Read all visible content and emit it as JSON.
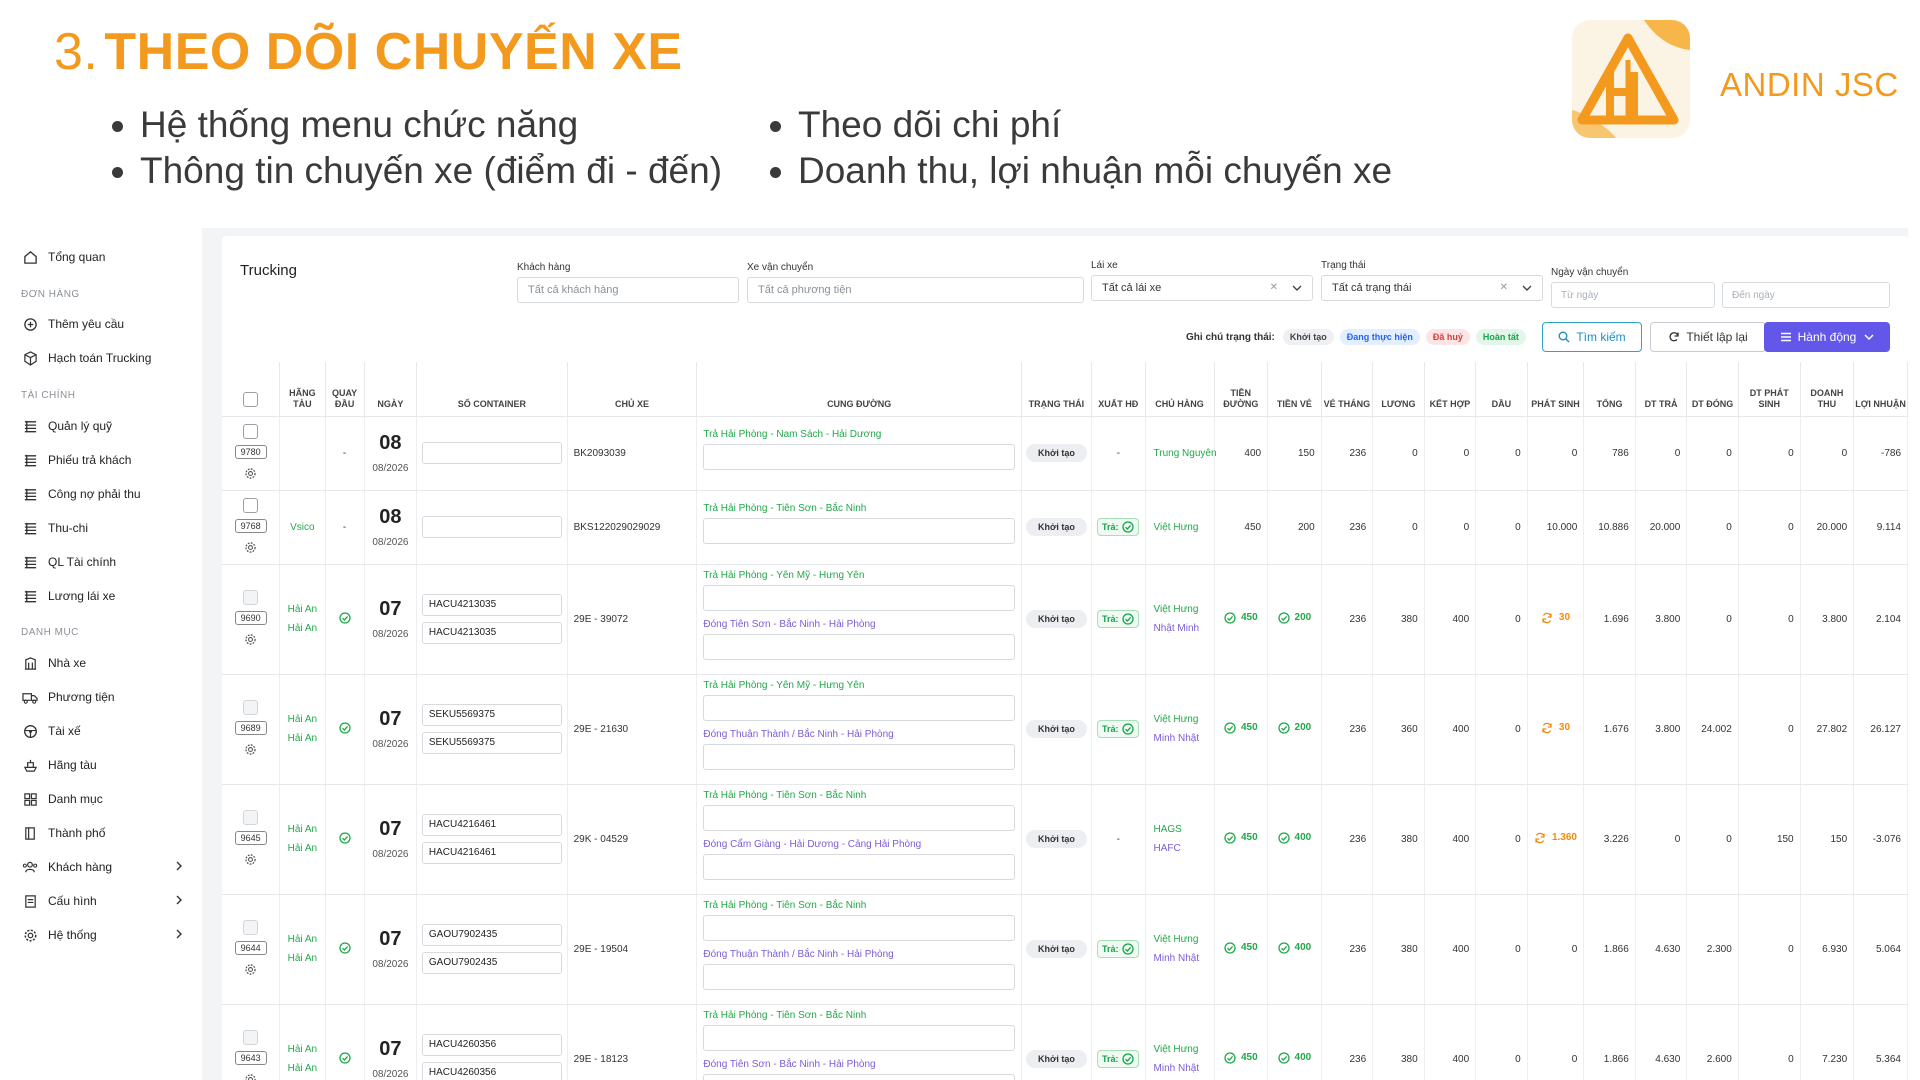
{
  "slide": {
    "number": "3.",
    "title": "THEO DÕI CHUYẾN XE",
    "bullets_left": [
      "Hệ thống menu chức năng",
      "Thông tin chuyến xe (điểm đi - đến)"
    ],
    "bullets_right": [
      "Theo dõi chi phí",
      "Doanh thu, lợi nhuận mỗi chuyến xe"
    ],
    "company": "ANDIN JSC"
  },
  "colors": {
    "accent": "#f39a1e",
    "primary_button": "#6257e8",
    "success": "#20a84a",
    "route_return": "#7c5cd6",
    "warning": "#f28a12"
  },
  "sidebar": {
    "overview": "Tổng quan",
    "sections": {
      "orders": "ĐƠN HÀNG",
      "finance": "TÀI CHÍNH",
      "catalog": "DANH MỤC"
    },
    "orders": [
      "Thêm yêu cầu",
      "Hạch toán Trucking"
    ],
    "finance": [
      "Quản lý quỹ",
      "Phiếu trả khách",
      "Công nợ phải thu",
      "Thu-chi",
      "QL Tài chính",
      "Lương lái xe"
    ],
    "catalog": [
      "Nhà xe",
      "Phương tiện",
      "Tài xế",
      "Hãng tàu",
      "Danh mục",
      "Thành phố",
      "Khách hàng",
      "Cấu hình",
      "Hệ thống"
    ]
  },
  "filters": {
    "title": "Trucking",
    "customer_label": "Khách hàng",
    "customer_ph": "Tất cả khách hàng",
    "vehicle_label": "Xe vận chuyển",
    "vehicle_ph": "Tất cả phương tiện",
    "driver_label": "Lái xe",
    "driver_value": "Tất cả lái xe",
    "status_label": "Trạng thái",
    "status_value": "Tất cả trạng thái",
    "date_label": "Ngày vận chuyển",
    "from_ph": "Từ ngày",
    "to_ph": "Đến ngày",
    "status_note_label": "Ghi chú trạng thái:",
    "status_legend": [
      "Khởi tạo",
      "Đang thực hiện",
      "Đã huỷ",
      "Hoàn tất"
    ],
    "search_btn": "Tìm kiếm",
    "reset_btn": "Thiết lập lại",
    "action_btn": "Hành động"
  },
  "table": {
    "headers": [
      "",
      "HÃNG TÀU",
      "QUAY ĐẦU",
      "NGÀY",
      "SỐ CONTAINER",
      "CHỦ XE",
      "CUNG ĐƯỜNG",
      "TRẠNG THÁI",
      "XUẤT HĐ",
      "CHỦ HÀNG",
      "TIỀN ĐƯỜNG",
      "TIỀN VÉ",
      "VÉ THÁNG",
      "LƯƠNG",
      "KẾT HỢP",
      "DẦU",
      "PHÁT SINH",
      "TỔNG",
      "DT TRẢ",
      "DT ĐÓNG",
      "DT PHÁT SINH",
      "DOANH THU",
      "LỢI NHUẬN"
    ],
    "tra_label": "Trả:",
    "rows": [
      {
        "id": "9780",
        "carrier": [],
        "turn": "-",
        "day": "08",
        "month": "08/2026",
        "containers": [
          ""
        ],
        "owner": "BK2093039",
        "routes": [
          "Trả Hải Phòng - Nam Sách - Hải Dương"
        ],
        "status": "Khởi tạo",
        "invoice": "-",
        "shippers": [
          "Trung Nguyên"
        ],
        "road": "400",
        "road_ok": false,
        "ticket": "150",
        "ticket_ok": false,
        "monthly": "236",
        "salary": "0",
        "combined": "0",
        "fuel": "0",
        "extra": "0",
        "extra_warn": false,
        "total": "786",
        "dt_return": "0",
        "dt_close": "0",
        "dt_extra": "0",
        "revenue": "0",
        "profit": "-786"
      },
      {
        "id": "9768",
        "carrier": [
          "Vsico"
        ],
        "turn": "-",
        "day": "08",
        "month": "08/2026",
        "containers": [
          ""
        ],
        "owner": "BKS122029029029",
        "routes": [
          "Trả Hải Phòng - Tiên Sơn - Bắc Ninh"
        ],
        "status": "Khởi tạo",
        "invoice": "tra",
        "shippers": [
          "Việt Hưng"
        ],
        "road": "450",
        "road_ok": false,
        "ticket": "200",
        "ticket_ok": false,
        "monthly": "236",
        "salary": "0",
        "combined": "0",
        "fuel": "0",
        "extra": "10.000",
        "extra_warn": false,
        "total": "10.886",
        "dt_return": "20.000",
        "dt_close": "0",
        "dt_extra": "0",
        "revenue": "20.000",
        "profit": "9.114"
      },
      {
        "id": "9690",
        "carrier": [
          "Hải An",
          "Hải An"
        ],
        "turn": "ok",
        "day": "07",
        "month": "08/2026",
        "containers": [
          "HACU4213035",
          "HACU4213035"
        ],
        "owner": "29E - 39072",
        "routes": [
          "Trả Hải Phòng - Yên Mỹ - Hưng Yên",
          "Đóng Tiên Sơn - Bắc Ninh - Hải Phòng"
        ],
        "status": "Khởi tạo",
        "invoice": "tra",
        "shippers": [
          "Việt Hưng",
          "Nhật Minh"
        ],
        "road": "450",
        "road_ok": true,
        "ticket": "200",
        "ticket_ok": true,
        "monthly": "236",
        "salary": "380",
        "combined": "400",
        "fuel": "0",
        "extra": "30",
        "extra_warn": true,
        "total": "1.696",
        "dt_return": "3.800",
        "dt_close": "0",
        "dt_extra": "0",
        "revenue": "3.800",
        "profit": "2.104"
      },
      {
        "id": "9689",
        "carrier": [
          "Hải An",
          "Hải An"
        ],
        "turn": "ok",
        "day": "07",
        "month": "08/2026",
        "containers": [
          "SEKU5569375",
          "SEKU5569375"
        ],
        "owner": "29E - 21630",
        "routes": [
          "Trả Hải Phòng - Yên Mỹ - Hưng Yên",
          "Đóng Thuận Thành / Bắc Ninh - Hải Phòng"
        ],
        "status": "Khởi tạo",
        "invoice": "tra",
        "shippers": [
          "Việt Hưng",
          "Minh Nhật"
        ],
        "road": "450",
        "road_ok": true,
        "ticket": "200",
        "ticket_ok": true,
        "monthly": "236",
        "salary": "360",
        "combined": "400",
        "fuel": "0",
        "extra": "30",
        "extra_warn": true,
        "total": "1.676",
        "dt_return": "3.800",
        "dt_close": "24.002",
        "dt_extra": "0",
        "revenue": "27.802",
        "profit": "26.127"
      },
      {
        "id": "9645",
        "carrier": [
          "Hải An",
          "Hải An"
        ],
        "turn": "ok",
        "day": "07",
        "month": "08/2026",
        "containers": [
          "HACU4216461",
          "HACU4216461"
        ],
        "owner": "29K - 04529",
        "routes": [
          "Trả Hải Phòng - Tiên Sơn - Bắc Ninh",
          "Đóng Cẩm Giàng - Hải Dương - Cảng Hải Phòng"
        ],
        "status": "Khởi tạo",
        "invoice": "-",
        "shippers": [
          "HAGS",
          "HAFC"
        ],
        "road": "450",
        "road_ok": true,
        "ticket": "400",
        "ticket_ok": true,
        "monthly": "236",
        "salary": "380",
        "combined": "400",
        "fuel": "0",
        "extra": "1.360",
        "extra_warn": true,
        "total": "3.226",
        "dt_return": "0",
        "dt_close": "0",
        "dt_extra": "150",
        "revenue": "150",
        "profit": "-3.076"
      },
      {
        "id": "9644",
        "carrier": [
          "Hải An",
          "Hải An"
        ],
        "turn": "ok",
        "day": "07",
        "month": "08/2026",
        "containers": [
          "GAOU7902435",
          "GAOU7902435"
        ],
        "owner": "29E - 19504",
        "routes": [
          "Trả Hải Phòng - Tiên Sơn - Bắc Ninh",
          "Đóng Thuận Thành / Bắc Ninh - Hải Phòng"
        ],
        "status": "Khởi tạo",
        "invoice": "tra",
        "shippers": [
          "Việt Hưng",
          "Minh Nhật"
        ],
        "road": "450",
        "road_ok": true,
        "ticket": "400",
        "ticket_ok": true,
        "monthly": "236",
        "salary": "380",
        "combined": "400",
        "fuel": "0",
        "extra": "0",
        "extra_warn": false,
        "total": "1.866",
        "dt_return": "4.630",
        "dt_close": "2.300",
        "dt_extra": "0",
        "revenue": "6.930",
        "profit": "5.064"
      },
      {
        "id": "9643",
        "carrier": [
          "Hải An",
          "Hải An"
        ],
        "turn": "ok",
        "day": "07",
        "month": "08/2026",
        "containers": [
          "HACU4260356",
          "HACU4260356"
        ],
        "owner": "29E - 18123",
        "routes": [
          "Trả Hải Phòng - Tiên Sơn - Bắc Ninh",
          "Đóng Tiên Sơn - Bắc Ninh - Hải Phòng"
        ],
        "status": "Khởi tạo",
        "invoice": "tra",
        "shippers": [
          "Việt Hưng",
          "Minh Nhật"
        ],
        "road": "450",
        "road_ok": true,
        "ticket": "400",
        "ticket_ok": true,
        "monthly": "236",
        "salary": "380",
        "combined": "400",
        "fuel": "0",
        "extra": "0",
        "extra_warn": false,
        "total": "1.866",
        "dt_return": "4.630",
        "dt_close": "2.600",
        "dt_extra": "0",
        "revenue": "7.230",
        "profit": "5.364"
      }
    ]
  }
}
